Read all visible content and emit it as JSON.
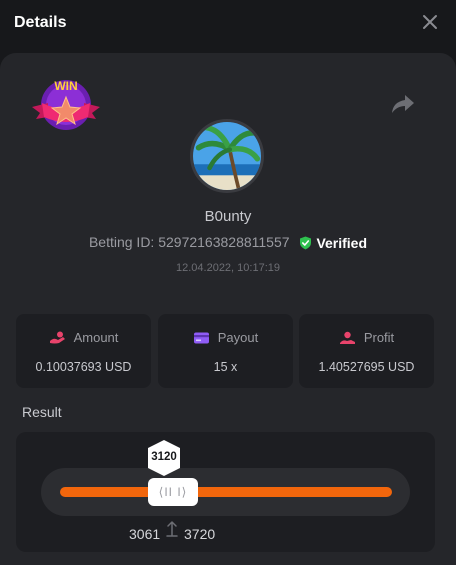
{
  "header": {
    "title": "Details"
  },
  "badge": {
    "text": "WIN"
  },
  "user": {
    "name": "B0unty",
    "betting_id_label": "Betting ID:",
    "betting_id": "52972163828811557",
    "verified_label": "Verified",
    "datetime": "12.04.2022, 10:17:19"
  },
  "stats": [
    {
      "label": "Amount",
      "value": "0.10037693 USD",
      "icon": "amount-icon",
      "color": "#e8436b"
    },
    {
      "label": "Payout",
      "value": "15 x",
      "icon": "card-icon",
      "color": "#8f5cf6"
    },
    {
      "label": "Profit",
      "value": "1.40527695 USD",
      "icon": "profit-icon",
      "color": "#e8436b"
    }
  ],
  "result": {
    "label": "Result",
    "marker_value": "3120",
    "handle_glyph": "⟨II I⟩",
    "range_low": "3061",
    "range_high": "3720",
    "accent": "#f2660c"
  },
  "colors": {
    "verified": "#2fc14f",
    "panel": "#25262a",
    "background": "#17181b"
  }
}
